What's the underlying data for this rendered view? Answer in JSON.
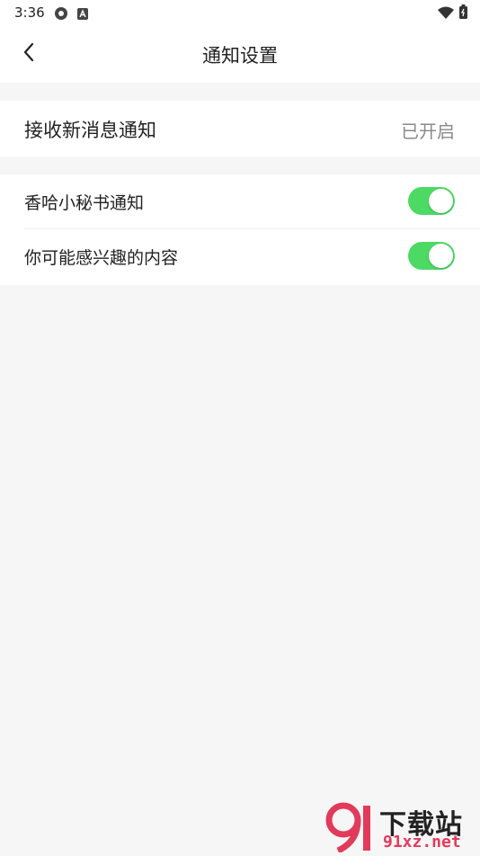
{
  "status_bar": {
    "time": "3:36",
    "icons": [
      "notification-icon",
      "text-icon",
      "wifi-icon",
      "battery-icon"
    ]
  },
  "header": {
    "title": "通知设置",
    "back_icon": "chevron-left-icon"
  },
  "main_setting": {
    "label": "接收新消息通知",
    "value": "已开启"
  },
  "toggles": [
    {
      "label": "香哈小秘书通知",
      "enabled": true
    },
    {
      "label": "你可能感兴趣的内容",
      "enabled": true
    }
  ],
  "colors": {
    "toggle_on": "#4cd964",
    "background": "#f6f6f6",
    "card": "#ffffff",
    "watermark_accent": "#e23a5b"
  },
  "watermark": {
    "logo": "下载站",
    "site": "91xz.net"
  }
}
